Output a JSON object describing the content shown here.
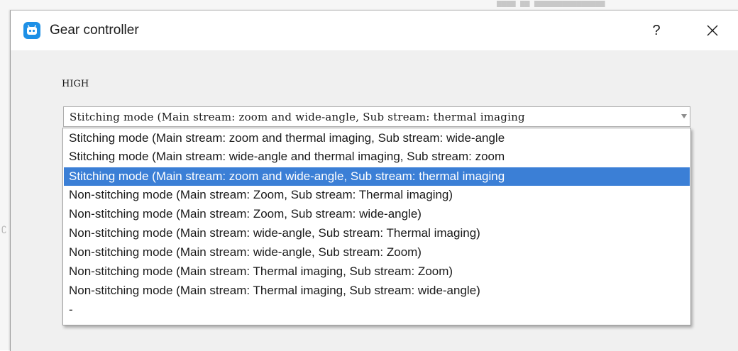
{
  "window": {
    "title": "Gear controller",
    "help_label": "?"
  },
  "level_label": "HIGH",
  "combo": {
    "selected_value": "Stitching mode (Main stream: zoom and wide-angle, Sub stream: thermal imaging"
  },
  "dropdown": {
    "selected_index": 2,
    "options": [
      "Stitching mode (Main stream: zoom and thermal imaging, Sub stream: wide-angle",
      "Stitching mode (Main stream: wide-angle and thermal imaging, Sub stream: zoom",
      "Stitching mode (Main stream: zoom and wide-angle, Sub stream: thermal imaging",
      "Non-stitching mode (Main stream: Zoom, Sub stream: Thermal imaging)",
      "Non-stitching mode (Main stream: Zoom, Sub stream: wide-angle)",
      "Non-stitching mode (Main stream: wide-angle, Sub stream: Thermal imaging)",
      "Non-stitching mode (Main stream: wide-angle, Sub stream: Zoom)",
      "Non-stitching mode (Main stream: Thermal imaging, Sub stream: Zoom)",
      "Non-stitching mode (Main stream: Thermal imaging, Sub stream: wide-angle)",
      "-"
    ]
  },
  "colors": {
    "selection": "#3b7fd6",
    "app_icon": "#1e90e6"
  },
  "icons": {
    "app": "robot-icon",
    "help": "help-icon",
    "close": "close-icon",
    "dropdown": "chevron-down-icon"
  }
}
